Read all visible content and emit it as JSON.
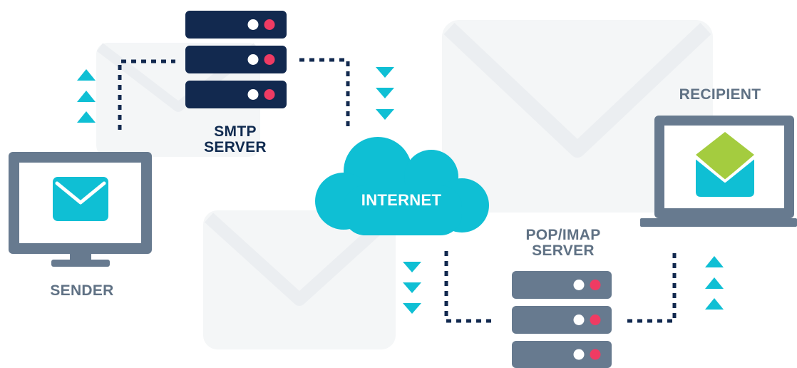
{
  "labels": {
    "smtp_line1": "SMTP",
    "smtp_line2": "SERVER",
    "internet": "INTERNET",
    "pop_line1": "POP/IMAP",
    "pop_line2": "SERVER",
    "sender": "SENDER",
    "recipient": "RECIPIENT"
  },
  "colors": {
    "navy": "#12294f",
    "slate": "#677a8f",
    "teal": "#0fbfd4",
    "led_white": "#ffffff",
    "led_red": "#ef3b63",
    "green": "#a4cc3f",
    "watermark": "#f4f6f7"
  },
  "icons": {
    "smtp_server": "server-stack-icon",
    "pop_server": "server-stack-icon",
    "internet": "cloud-icon",
    "sender": "desktop-monitor-icon",
    "recipient": "laptop-icon",
    "mail": "envelope-icon",
    "open_mail": "open-envelope-icon",
    "arrow_up": "triangle-up-icon",
    "arrow_down": "triangle-down-icon"
  }
}
